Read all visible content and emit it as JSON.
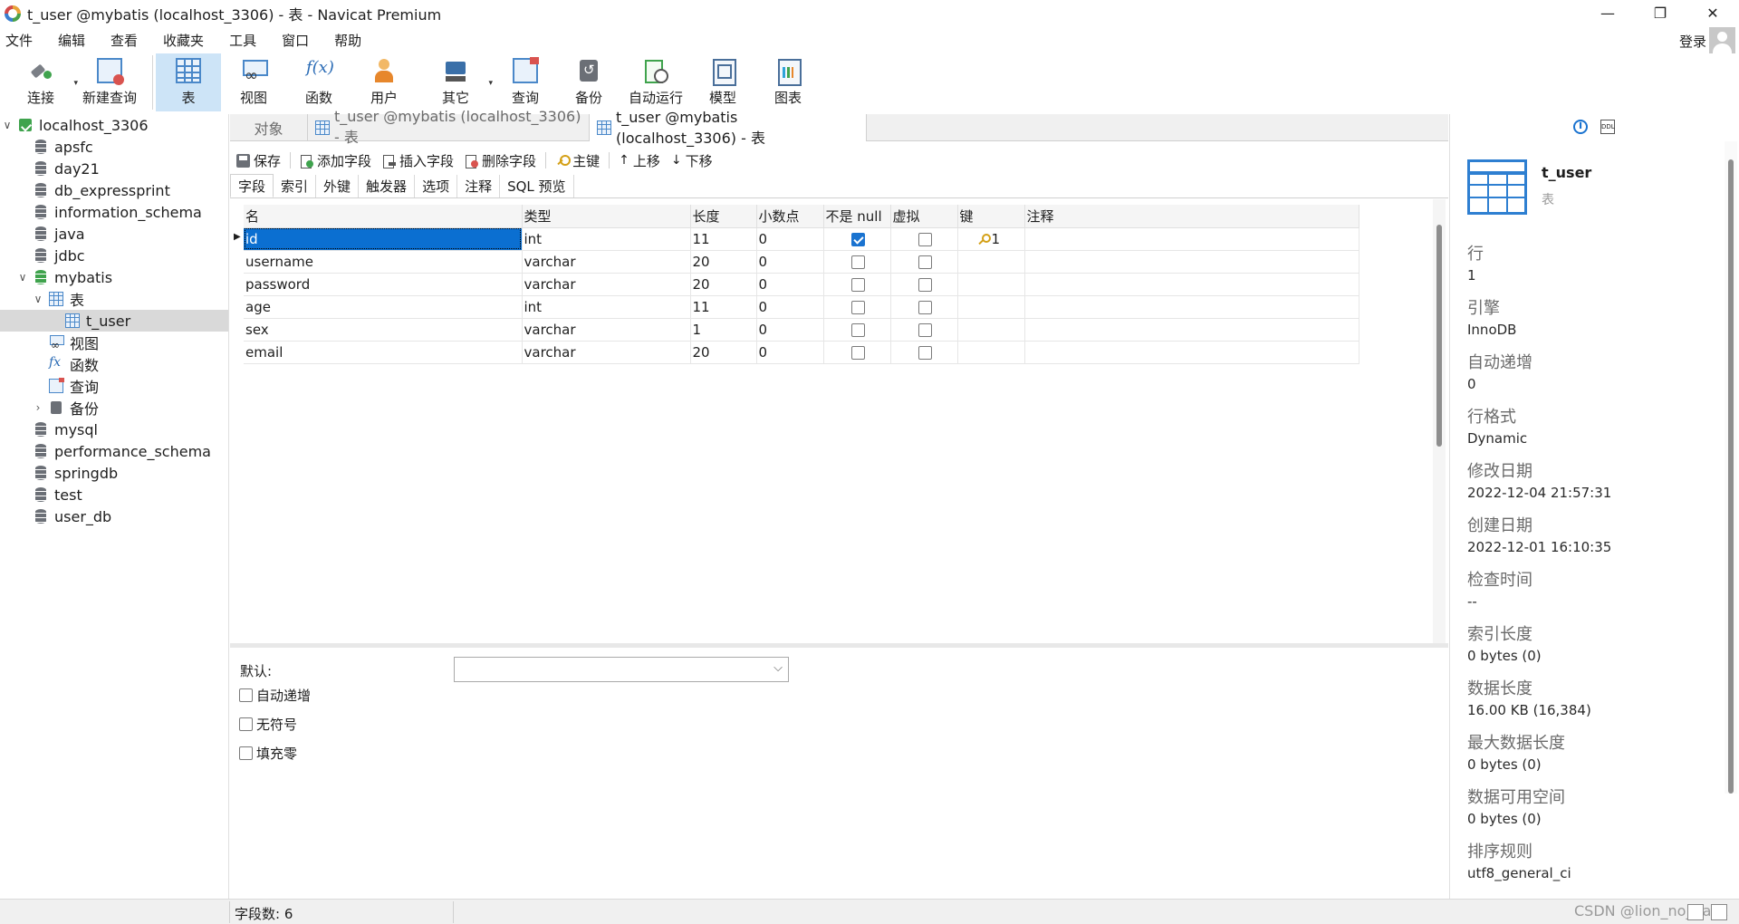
{
  "window": {
    "title": "t_user @mybatis (localhost_3306) - 表 - Navicat Premium",
    "minimize": "—",
    "restore": "❐",
    "close": "✕"
  },
  "menu": [
    "文件",
    "编辑",
    "查看",
    "收藏夹",
    "工具",
    "窗口",
    "帮助"
  ],
  "account": {
    "login": "登录"
  },
  "toolbar": [
    {
      "label": "连接",
      "icon": "plug-icon",
      "dropdown": true
    },
    {
      "label": "新建查询",
      "icon": "new-query-icon"
    },
    {
      "label": "表",
      "icon": "table-icon",
      "active": true
    },
    {
      "label": "视图",
      "icon": "view-icon"
    },
    {
      "label": "函数",
      "icon": "function-icon"
    },
    {
      "label": "用户",
      "icon": "user-icon"
    },
    {
      "label": "其它",
      "icon": "tools-icon",
      "dropdown": true
    },
    {
      "label": "查询",
      "icon": "query-icon"
    },
    {
      "label": "备份",
      "icon": "backup-icon"
    },
    {
      "label": "自动运行",
      "icon": "auto-run-icon"
    },
    {
      "label": "模型",
      "icon": "model-icon"
    },
    {
      "label": "图表",
      "icon": "chart-icon"
    }
  ],
  "tree": [
    {
      "label": "localhost_3306",
      "level": 0,
      "icon": "server-icon",
      "chevron": "∨"
    },
    {
      "label": "apsfc",
      "level": 1,
      "icon": "database-icon"
    },
    {
      "label": "day21",
      "level": 1,
      "icon": "database-icon"
    },
    {
      "label": "db_expressprint",
      "level": 1,
      "icon": "database-icon"
    },
    {
      "label": "information_schema",
      "level": 1,
      "icon": "database-icon"
    },
    {
      "label": "java",
      "level": 1,
      "icon": "database-icon"
    },
    {
      "label": "jdbc",
      "level": 1,
      "icon": "database-icon"
    },
    {
      "label": "mybatis",
      "level": 1,
      "icon": "database-open-icon",
      "chevron": "∨"
    },
    {
      "label": "表",
      "level": 2,
      "icon": "table-icon",
      "chevron": "∨"
    },
    {
      "label": "t_user",
      "level": 3,
      "icon": "table-icon",
      "selected": true
    },
    {
      "label": "视图",
      "level": 2,
      "icon": "view-icon"
    },
    {
      "label": "函数",
      "level": 2,
      "icon": "function-icon"
    },
    {
      "label": "查询",
      "level": 2,
      "icon": "query-icon"
    },
    {
      "label": "备份",
      "level": 2,
      "icon": "backup-icon",
      "chevron": "›"
    },
    {
      "label": "mysql",
      "level": 1,
      "icon": "database-icon"
    },
    {
      "label": "performance_schema",
      "level": 1,
      "icon": "database-icon"
    },
    {
      "label": "springdb",
      "level": 1,
      "icon": "database-icon"
    },
    {
      "label": "test",
      "level": 1,
      "icon": "database-icon"
    },
    {
      "label": "user_db",
      "level": 1,
      "icon": "database-icon"
    }
  ],
  "tabs": [
    {
      "label": "对象",
      "active": false
    },
    {
      "label": "t_user @mybatis (localhost_3306) - 表",
      "active": false
    },
    {
      "label": "t_user @mybatis (localhost_3306) - 表",
      "active": true
    }
  ],
  "editor_toolbar": {
    "save": "保存",
    "add_field": "添加字段",
    "insert_field": "插入字段",
    "delete_field": "删除字段",
    "primary_key": "主键",
    "move_up": "上移",
    "move_down": "下移"
  },
  "subtabs": [
    "字段",
    "索引",
    "外键",
    "触发器",
    "选项",
    "注释",
    "SQL 预览"
  ],
  "columns": [
    "名",
    "类型",
    "长度",
    "小数点",
    "不是 null",
    "虚拟",
    "键",
    "注释"
  ],
  "rows": [
    {
      "name": "id",
      "type": "int",
      "length": "11",
      "decimals": "0",
      "not_null": true,
      "virtual": false,
      "key": "1"
    },
    {
      "name": "username",
      "type": "varchar",
      "length": "20",
      "decimals": "0",
      "not_null": false,
      "virtual": false,
      "key": ""
    },
    {
      "name": "password",
      "type": "varchar",
      "length": "20",
      "decimals": "0",
      "not_null": false,
      "virtual": false,
      "key": ""
    },
    {
      "name": "age",
      "type": "int",
      "length": "11",
      "decimals": "0",
      "not_null": false,
      "virtual": false,
      "key": ""
    },
    {
      "name": "sex",
      "type": "varchar",
      "length": "1",
      "decimals": "0",
      "not_null": false,
      "virtual": false,
      "key": ""
    },
    {
      "name": "email",
      "type": "varchar",
      "length": "20",
      "decimals": "0",
      "not_null": false,
      "virtual": false,
      "key": ""
    }
  ],
  "field_props": {
    "default_label": "默认:",
    "default_value": "",
    "options": [
      "自动递增",
      "无符号",
      "填充零"
    ]
  },
  "status": {
    "field_count": "字段数: 6",
    "watermark": "CSDN @lion_no_back"
  },
  "info": {
    "name": "t_user",
    "type": "表",
    "items": [
      {
        "label": "行",
        "value": "1"
      },
      {
        "label": "引擎",
        "value": "InnoDB"
      },
      {
        "label": "自动递增",
        "value": "0"
      },
      {
        "label": "行格式",
        "value": "Dynamic"
      },
      {
        "label": "修改日期",
        "value": "2022-12-04 21:57:31"
      },
      {
        "label": "创建日期",
        "value": "2022-12-01 16:10:35"
      },
      {
        "label": "检查时间",
        "value": "--"
      },
      {
        "label": "索引长度",
        "value": "0 bytes (0)"
      },
      {
        "label": "数据长度",
        "value": "16.00 KB (16,384)"
      },
      {
        "label": "最大数据长度",
        "value": "0 bytes (0)"
      },
      {
        "label": "数据可用空间",
        "value": "0 bytes (0)"
      },
      {
        "label": "排序规则",
        "value": "utf8_general_ci"
      }
    ]
  }
}
